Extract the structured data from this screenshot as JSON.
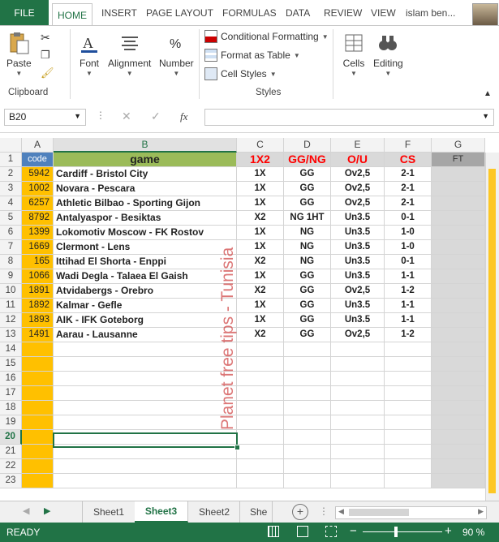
{
  "ribbon_tabs": {
    "file": "FILE",
    "home": "HOME",
    "insert": "INSERT",
    "page_layout": "PAGE LAYOUT",
    "formulas": "FORMULAS",
    "data": "DATA",
    "review": "REVIEW",
    "view": "VIEW",
    "user": "islam ben..."
  },
  "ribbon": {
    "paste": "Paste",
    "clipboard": "Clipboard",
    "font": "Font",
    "alignment": "Alignment",
    "number": "Number",
    "conditional_formatting": "Conditional Formatting",
    "format_as_table": "Format as Table",
    "cell_styles": "Cell Styles",
    "styles": "Styles",
    "cells": "Cells",
    "editing": "Editing"
  },
  "formula_bar": {
    "name_box": "B20",
    "fx": "fx",
    "value": ""
  },
  "columns": [
    "A",
    "B",
    "C",
    "D",
    "E",
    "F",
    "G"
  ],
  "header_row": {
    "num": "1",
    "code": "code",
    "game": "game",
    "x12": "1X2",
    "ggng": "GG/NG",
    "ou": "O/U",
    "cs": "CS",
    "ft": "FT"
  },
  "rows": [
    {
      "num": "2",
      "code": "5942",
      "game": "Cardiff - Bristol City",
      "x12": "1X",
      "ggng": "GG",
      "ou": "Ov2,5",
      "cs": "2-1"
    },
    {
      "num": "3",
      "code": "1002",
      "game": "Novara - Pescara",
      "x12": "1X",
      "ggng": "GG",
      "ou": "Ov2,5",
      "cs": "2-1"
    },
    {
      "num": "4",
      "code": "6257",
      "game": "Athletic Bilbao - Sporting Gijon",
      "x12": "1X",
      "ggng": "GG",
      "ou": "Ov2,5",
      "cs": "2-1"
    },
    {
      "num": "5",
      "code": "8792",
      "game": "Antalyaspor - Besiktas",
      "x12": "X2",
      "ggng": "NG 1HT",
      "ou": "Un3.5",
      "cs": "0-1"
    },
    {
      "num": "6",
      "code": "1399",
      "game": "Lokomotiv Moscow - FK Rostov",
      "x12": "1X",
      "ggng": "NG",
      "ou": "Un3.5",
      "cs": "1-0"
    },
    {
      "num": "7",
      "code": "1669",
      "game": "Clermont - Lens",
      "x12": "1X",
      "ggng": "NG",
      "ou": "Un3.5",
      "cs": "1-0"
    },
    {
      "num": "8",
      "code": "165",
      "game": "Ittihad El Shorta - Enppi",
      "x12": "X2",
      "ggng": "NG",
      "ou": "Un3.5",
      "cs": "0-1"
    },
    {
      "num": "9",
      "code": "1066",
      "game": "Wadi Degla - Talaea El Gaish",
      "x12": "1X",
      "ggng": "GG",
      "ou": "Un3.5",
      "cs": "1-1"
    },
    {
      "num": "10",
      "code": "1891",
      "game": "Atvidabergs - Orebro",
      "x12": "X2",
      "ggng": "GG",
      "ou": "Ov2,5",
      "cs": "1-2"
    },
    {
      "num": "11",
      "code": "1892",
      "game": "Kalmar - Gefle",
      "x12": "1X",
      "ggng": "GG",
      "ou": "Un3.5",
      "cs": "1-1"
    },
    {
      "num": "12",
      "code": "1893",
      "game": "AIK - IFK Goteborg",
      "x12": "1X",
      "ggng": "GG",
      "ou": "Un3.5",
      "cs": "1-1"
    },
    {
      "num": "13",
      "code": "1491",
      "game": "Aarau - Lausanne",
      "x12": "X2",
      "ggng": "GG",
      "ou": "Ov2,5",
      "cs": "1-2"
    }
  ],
  "empty_rows": [
    "14",
    "15",
    "16",
    "17",
    "18",
    "19",
    "20",
    "21",
    "22",
    "23"
  ],
  "watermark": "Planet free tips - Tunisia",
  "sheet_tabs": [
    "Sheet1",
    "Sheet3",
    "Sheet2",
    "She"
  ],
  "active_sheet": "Sheet3",
  "status": {
    "ready": "READY",
    "zoom": "90 %"
  },
  "colors": {
    "excel_green": "#217346",
    "code_fill": "#ffc000",
    "game_fill": "#9bbb59",
    "header_red": "#ff0000",
    "ft_fill": "#a6a6a6"
  }
}
